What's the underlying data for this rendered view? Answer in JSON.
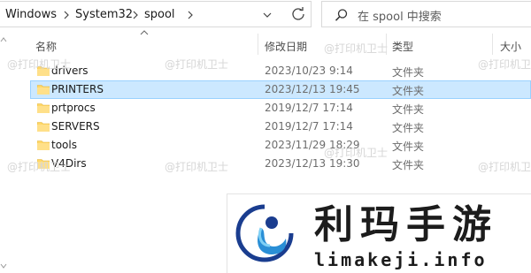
{
  "address_bar": {
    "breadcrumbs": [
      "Windows",
      "System32",
      "spool"
    ]
  },
  "search": {
    "placeholder": "在 spool 中搜索"
  },
  "columns": {
    "name": "名称",
    "modified": "修改日期",
    "type": "类型",
    "size": "大小"
  },
  "files": [
    {
      "name": "drivers",
      "modified": "2023/10/23 9:14",
      "type": "文件夹",
      "selected": false
    },
    {
      "name": "PRINTERS",
      "modified": "2023/12/13 19:45",
      "type": "文件夹",
      "selected": true
    },
    {
      "name": "prtprocs",
      "modified": "2019/12/7 17:14",
      "type": "文件夹",
      "selected": false
    },
    {
      "name": "SERVERS",
      "modified": "2019/12/7 17:14",
      "type": "文件夹",
      "selected": false
    },
    {
      "name": "tools",
      "modified": "2023/11/29 18:29",
      "type": "文件夹",
      "selected": false
    },
    {
      "name": "V4Dirs",
      "modified": "2023/12/13 19:30",
      "type": "文件夹",
      "selected": false
    }
  ],
  "watermark": {
    "text": "@打印机卫士"
  },
  "logo": {
    "title": "利玛手游",
    "url": "limakeji.info"
  },
  "icons": {
    "separator": "chevron-right-icon",
    "dropdown": "chevron-down-icon",
    "refresh": "refresh-icon",
    "search": "search-icon",
    "folder": "folder-icon",
    "sort": "sort-up-icon"
  },
  "colors": {
    "selection_bg": "#cce8ff",
    "selection_border": "#99d1ff",
    "folder_yellow": "#ffd766"
  }
}
